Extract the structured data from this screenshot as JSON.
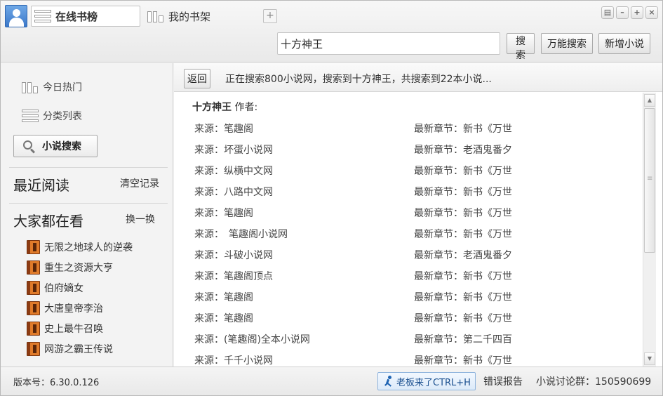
{
  "header": {
    "tabs": [
      {
        "label": "在线书榜"
      },
      {
        "label": "我的书架"
      }
    ],
    "add_tab_label": "+",
    "window_buttons": [
      "▤",
      "–",
      "+",
      "×"
    ]
  },
  "search": {
    "value": "十方神王",
    "search_label": "搜索",
    "global_search_label": "万能搜索",
    "add_novel_label": "新增小说"
  },
  "sidebar": {
    "nav": [
      {
        "label": "今日热门"
      },
      {
        "label": "分类列表"
      }
    ],
    "search_label": "小说搜索",
    "recent": {
      "title": "最近阅读",
      "action": "清空记录"
    },
    "popular": {
      "title": "大家都在看",
      "action": "换一换",
      "books": [
        "无限之地球人的逆袭",
        "重生之资源大亨",
        "伯府嫡女",
        "大唐皇帝李治",
        "史上最牛召唤",
        "网游之霸王传说"
      ]
    }
  },
  "main": {
    "back_label": "返回",
    "status": "正在搜索800小说网，搜索到十方神王，共搜索到22本小说...",
    "result_title": "十方神王",
    "author_label": "作者:",
    "rows": [
      {
        "source": "来源：笔趣阁",
        "chapter": "最新章节：新书《万世"
      },
      {
        "source": "来源：坏蛋小说网",
        "chapter": "最新章节：老酒鬼番夕"
      },
      {
        "source": "来源：纵横中文网",
        "chapter": "最新章节：新书《万世"
      },
      {
        "source": "来源：八路中文网",
        "chapter": "最新章节：新书《万世"
      },
      {
        "source": "来源：笔趣阁",
        "chapter": "最新章节：新书《万世"
      },
      {
        "source": "来源：　笔趣阁小说网",
        "chapter": "最新章节：新书《万世"
      },
      {
        "source": "来源：斗破小说网",
        "chapter": "最新章节：老酒鬼番夕"
      },
      {
        "source": "来源：笔趣阁顶点",
        "chapter": "最新章节：新书《万世"
      },
      {
        "source": "来源：笔趣阁",
        "chapter": "最新章节：新书《万世"
      },
      {
        "source": "来源：笔趣阁",
        "chapter": "最新章节：新书《万世"
      },
      {
        "source": "来源：(笔趣阁)全本小说网",
        "chapter": "最新章节：第二千四百"
      },
      {
        "source": "来源：千千小说网",
        "chapter": "最新章节：新书《万世"
      }
    ]
  },
  "footer": {
    "version": "版本号：6.30.0.126",
    "boss_label": "老板来了CTRL+H",
    "report_label": "错误报告",
    "group_label": "小说讨论群：150590699"
  },
  "colors": {
    "accent": "#3b78c9",
    "book_icon": "#e07b2a",
    "boss_button_text": "#1a4f8f"
  }
}
